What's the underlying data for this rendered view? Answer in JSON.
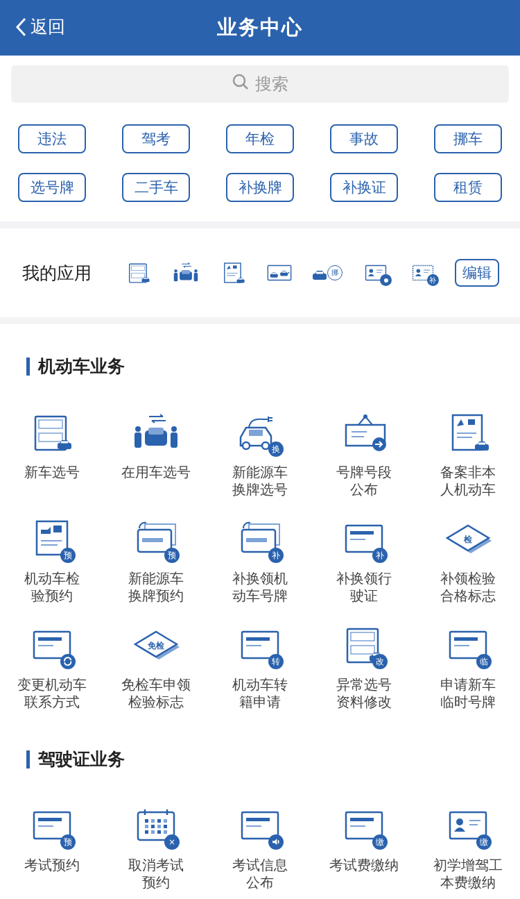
{
  "header": {
    "back": "返回",
    "title": "业务中心"
  },
  "search": {
    "placeholder": "搜索"
  },
  "tags": [
    "违法",
    "驾考",
    "年检",
    "事故",
    "挪车",
    "选号牌",
    "二手车",
    "补换牌",
    "补换证",
    "租赁"
  ],
  "my_apps": {
    "title": "我的应用",
    "apps": [
      {
        "kind": "plate-card"
      },
      {
        "kind": "people-car"
      },
      {
        "kind": "doc-car"
      },
      {
        "kind": "cars"
      },
      {
        "kind": "car-bubble",
        "badge": "挪"
      },
      {
        "kind": "id-card",
        "badge_symbol": {
          "kind": "dot"
        }
      },
      {
        "kind": "id-card-dashed",
        "badge": "补"
      }
    ],
    "edit": "编辑"
  },
  "sections": [
    {
      "title": "机动车业务",
      "items": [
        {
          "kind": "plate-card",
          "lines": [
            "新车选号"
          ]
        },
        {
          "kind": "people-car",
          "lines": [
            "在用车选号"
          ]
        },
        {
          "kind": "ev-car",
          "badge": "换",
          "lines": [
            "新能源车",
            "换牌选号"
          ]
        },
        {
          "kind": "sign",
          "lines": [
            "号牌号段",
            "公布"
          ]
        },
        {
          "kind": "doc-car",
          "lines": [
            "备案非本",
            "人机动车"
          ]
        },
        {
          "kind": "doc-check",
          "badge": "预",
          "lines": [
            "机动车检",
            "验预约"
          ]
        },
        {
          "kind": "plate",
          "badge": "预",
          "lines": [
            "新能源车",
            "换牌预约"
          ]
        },
        {
          "kind": "plate",
          "badge": "补",
          "lines": [
            "补换领机",
            "动车号牌"
          ]
        },
        {
          "kind": "card",
          "badge": "补",
          "lines": [
            "补换领行",
            "驶证"
          ]
        },
        {
          "kind": "diamond",
          "mark": "检",
          "lines": [
            "补领检验",
            "合格标志"
          ]
        },
        {
          "kind": "card",
          "badge_symbol": {
            "kind": "cycle"
          },
          "lines": [
            "变更机动车",
            "联系方式"
          ]
        },
        {
          "kind": "diamond",
          "mark": "免检",
          "lines": [
            "免检车申领",
            "检验标志"
          ]
        },
        {
          "kind": "card",
          "badge": "转",
          "lines": [
            "机动车转",
            "籍申请"
          ]
        },
        {
          "kind": "plate-card",
          "badge": "改",
          "lines": [
            "异常选号",
            "资料修改"
          ]
        },
        {
          "kind": "card",
          "badge": "临",
          "lines": [
            "申请新车",
            "临时号牌"
          ]
        }
      ]
    },
    {
      "title": "驾驶证业务",
      "items": [
        {
          "kind": "card",
          "badge": "预",
          "lines": [
            "考试预约"
          ]
        },
        {
          "kind": "calendar",
          "badge": "×",
          "lines": [
            "取消考试",
            "预约"
          ]
        },
        {
          "kind": "card",
          "badge_symbol": {
            "kind": "sound"
          },
          "lines": [
            "考试信息",
            "公布"
          ]
        },
        {
          "kind": "card",
          "badge": "缴",
          "lines": [
            "考试费缴纳"
          ]
        },
        {
          "kind": "id-card",
          "badge": "缴",
          "lines": [
            "初学增驾工",
            "本费缴纳"
          ]
        }
      ]
    }
  ]
}
